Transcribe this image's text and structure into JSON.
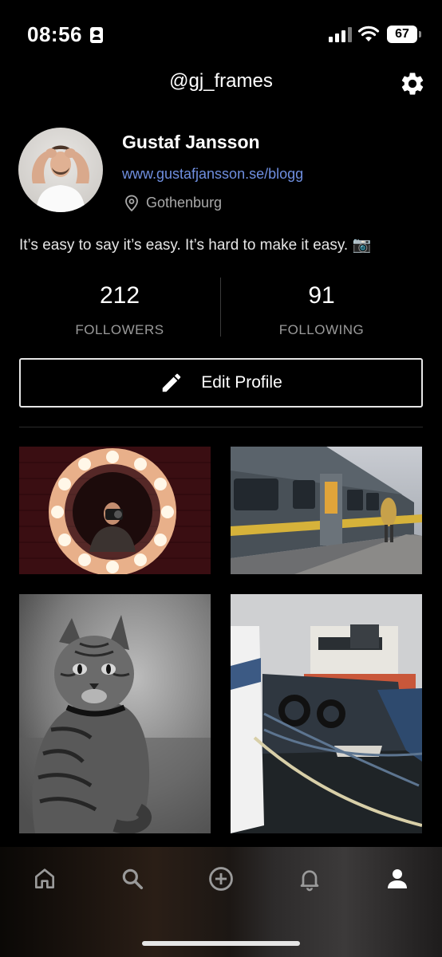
{
  "status_bar": {
    "time": "08:56",
    "battery": "67"
  },
  "header": {
    "handle": "@gj_frames"
  },
  "profile": {
    "name": "Gustaf Jansson",
    "website": "www.gustafjansson.se/blogg",
    "location": "Gothenburg",
    "bio": "It’s easy to say it’s easy. It’s hard to make it easy. 📷"
  },
  "stats": {
    "followers": {
      "count": "212",
      "label": "FOLLOWERS"
    },
    "following": {
      "count": "91",
      "label": "FOLLOWING"
    }
  },
  "edit_profile": {
    "label": "Edit Profile"
  },
  "colors": {
    "link": "#6f8fe0",
    "background": "#000000",
    "muted": "#9a9a9a"
  },
  "icons": [
    "settings-gear-icon",
    "location-pin-icon",
    "pencil-icon",
    "home-icon",
    "search-icon",
    "add-circle-icon",
    "bell-icon",
    "profile-icon"
  ]
}
